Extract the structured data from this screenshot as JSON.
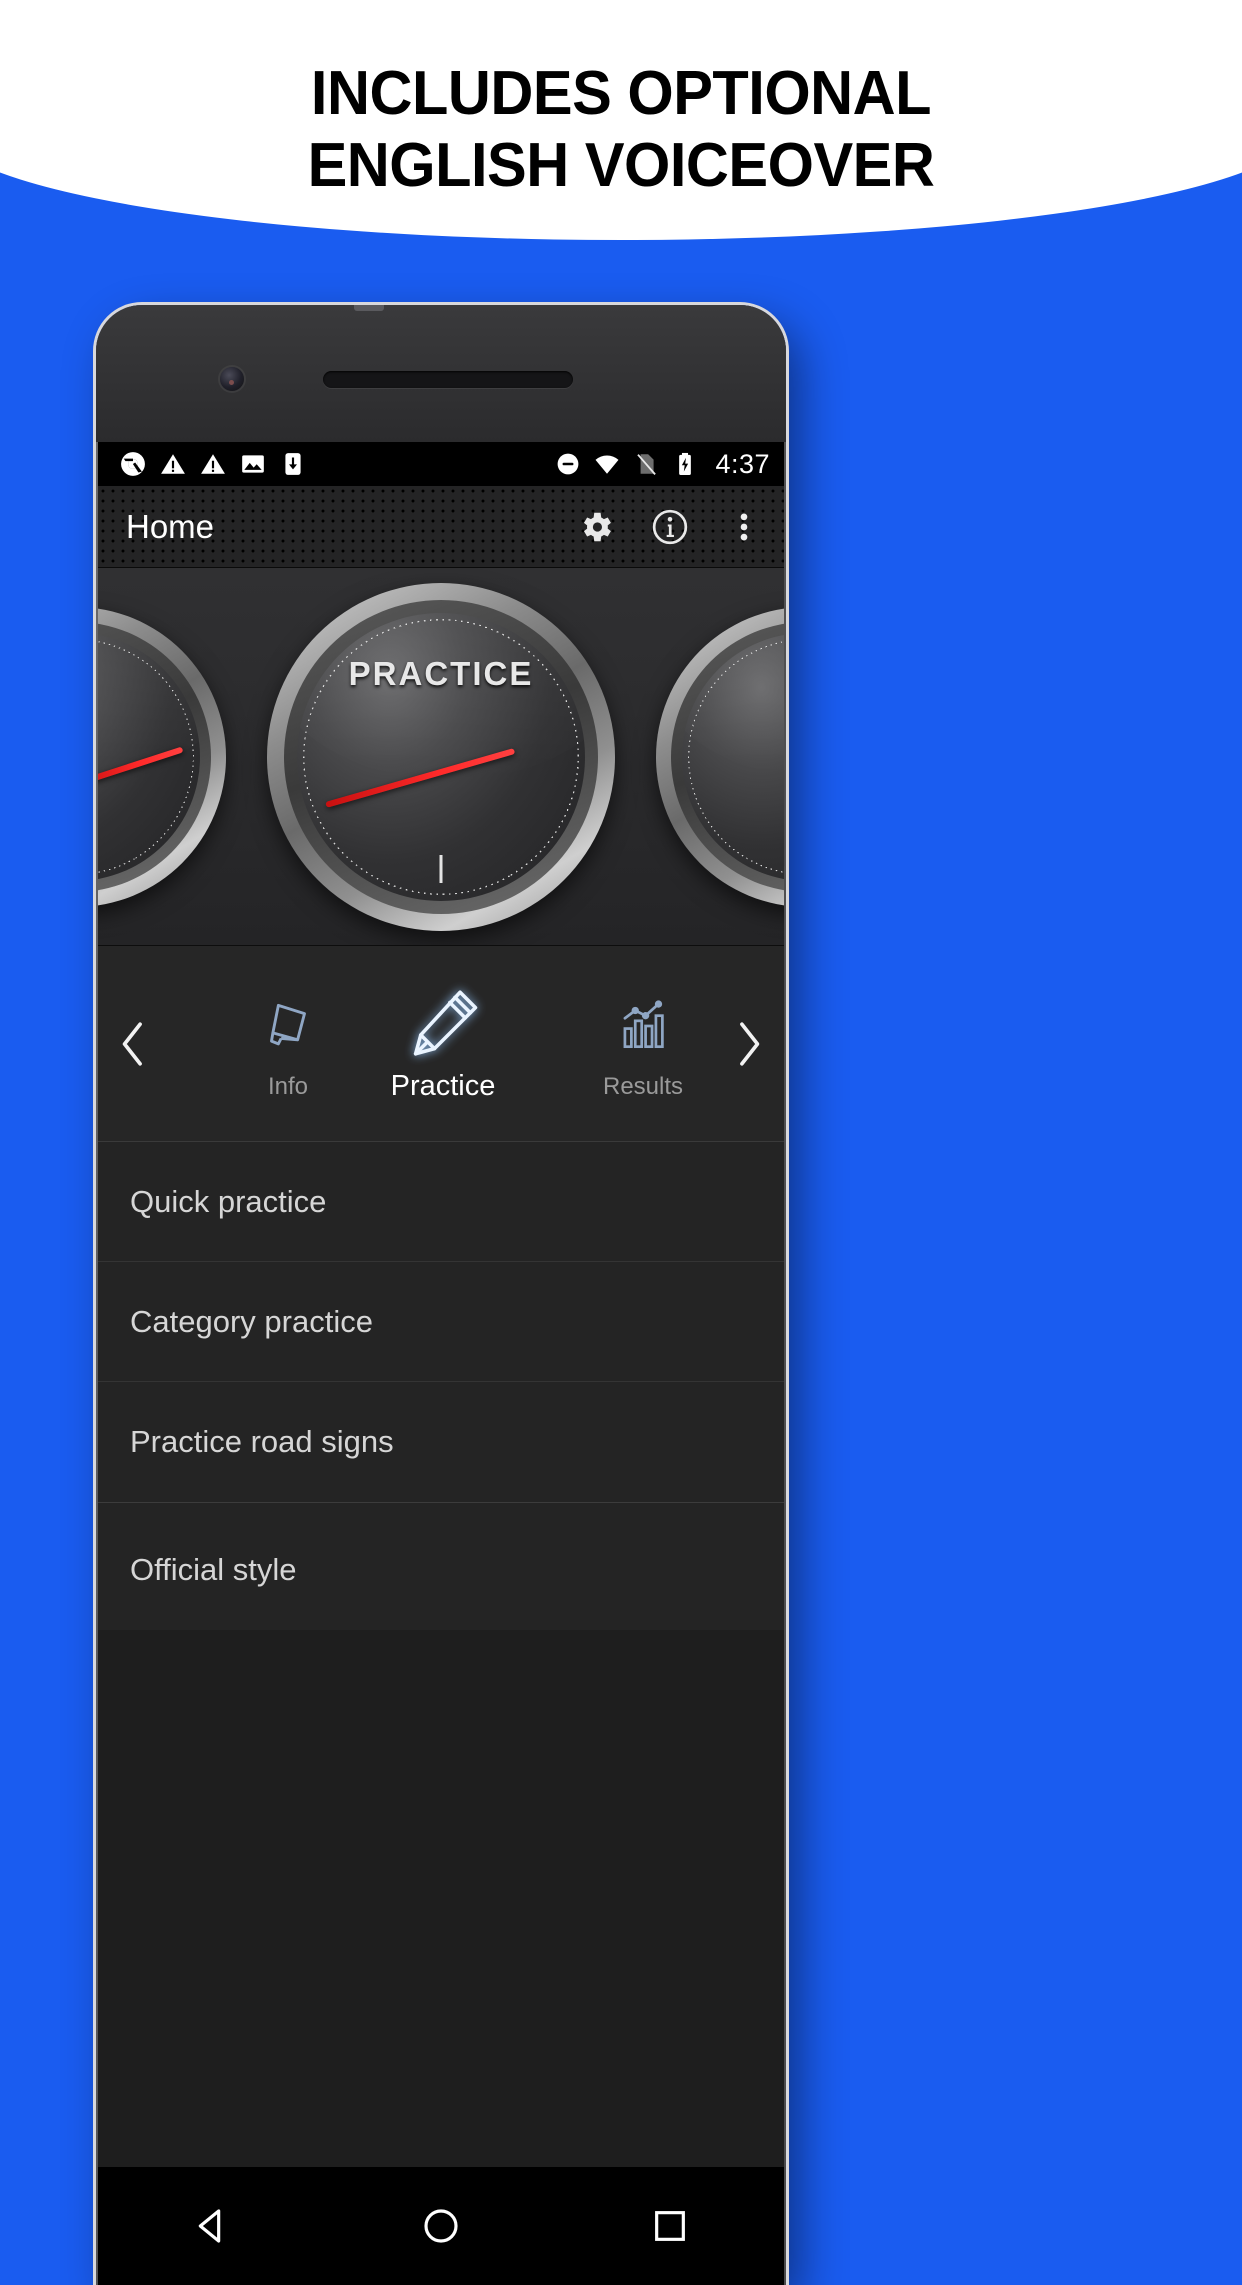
{
  "promo": {
    "headline_line1": "INCLUDES OPTIONAL",
    "headline_line2": "ENGLISH VOICEOVER",
    "background_color": "#1a5cf0",
    "banner_color": "#ffffff",
    "headline_color": "#000000"
  },
  "statusbar": {
    "left_icons": [
      "chrome-icon",
      "warning-icon",
      "warning-icon",
      "image-icon",
      "device-download-icon"
    ],
    "right_icons": [
      "do-not-disturb-icon",
      "wifi-icon",
      "no-sim-icon",
      "battery-charging-icon"
    ],
    "time": "4:37"
  },
  "appbar": {
    "title": "Home",
    "actions": [
      {
        "name": "settings-icon",
        "label": "Settings"
      },
      {
        "name": "info-icon",
        "label": "Info"
      },
      {
        "name": "overflow-menu-icon",
        "label": "More options"
      }
    ]
  },
  "gauges": {
    "center_label": "PRACTICE",
    "left_label": "",
    "right_label": "",
    "needle_color": "#ff2a2a"
  },
  "tabs": {
    "prev_label": "‹",
    "next_label": "›",
    "items": [
      {
        "label": "Info",
        "icon": "document-card-icon",
        "active": false
      },
      {
        "label": "Practice",
        "icon": "pencil-icon",
        "active": true
      },
      {
        "label": "Results",
        "icon": "bar-chart-icon",
        "active": false
      }
    ]
  },
  "list": {
    "items": [
      {
        "label": "Quick practice",
        "group": 1
      },
      {
        "label": "Category practice",
        "group": 1
      },
      {
        "label": "Practice road signs",
        "group": 1
      },
      {
        "label": "Official style",
        "group": 2
      }
    ]
  },
  "navbar": {
    "buttons": [
      {
        "name": "back-nav-icon",
        "label": "Back"
      },
      {
        "name": "home-nav-icon",
        "label": "Home"
      },
      {
        "name": "recents-nav-icon",
        "label": "Recents"
      }
    ]
  }
}
